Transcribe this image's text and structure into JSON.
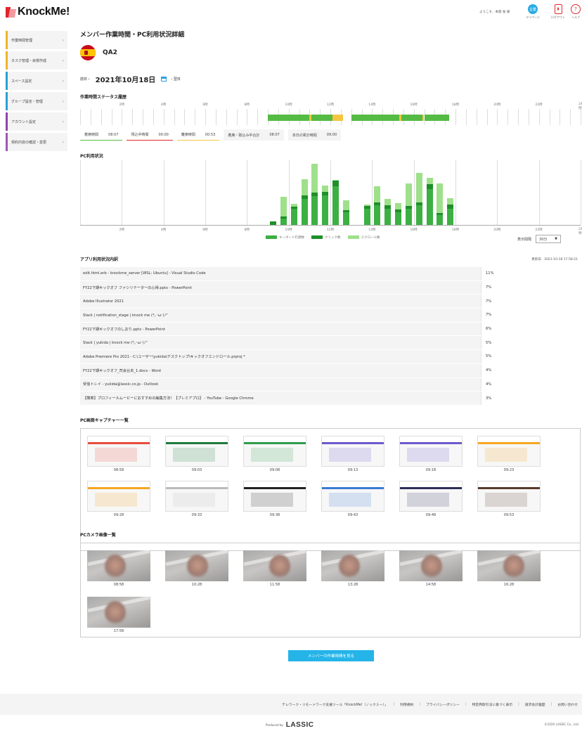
{
  "header": {
    "logo": "KnockMe!",
    "welcome": "ようこそ、本部 長 様",
    "icons": [
      {
        "name": "mypage-icon",
        "label": "マイページ",
        "badge": "企業",
        "color": "#29abe2"
      },
      {
        "name": "logout-icon",
        "label": "ログアウト",
        "color": "#e02a2a"
      },
      {
        "name": "help-icon",
        "label": "ヘルプ",
        "color": "#e02a2a"
      }
    ]
  },
  "sidebar": {
    "items": [
      {
        "label": "作業時間管理",
        "color": "#f0b429"
      },
      {
        "label": "タスク管理・目標作成",
        "color": "#f0b429"
      },
      {
        "label": "スペース設定",
        "color": "#2aa0d8"
      },
      {
        "label": "グループ設定・管理",
        "color": "#2aa0d8"
      },
      {
        "label": "アカウント設定",
        "color": "#8e44ad"
      },
      {
        "label": "契約内容の確認・変更",
        "color": "#9b59b6"
      }
    ]
  },
  "page": {
    "title": "メンバー作業時間・PC利用状況詳細",
    "member_name": "QA2",
    "prev": "前日",
    "date": "2021年10月18日",
    "next": "翌日"
  },
  "timeline": {
    "title": "作業時間ステータス履歴",
    "hours": [
      "2時",
      "4時",
      "6時",
      "8時",
      "10時",
      "12時",
      "14時",
      "16時",
      "18時",
      "20時",
      "22時",
      "24時"
    ],
    "segments": [
      {
        "start": 9.0,
        "end": 11.0,
        "status": "working"
      },
      {
        "start": 11.0,
        "end": 11.1,
        "status": "break"
      },
      {
        "start": 11.1,
        "end": 12.1,
        "status": "working"
      },
      {
        "start": 12.1,
        "end": 12.6,
        "status": "break"
      },
      {
        "start": 13.0,
        "end": 15.3,
        "status": "working"
      },
      {
        "start": 15.3,
        "end": 15.4,
        "status": "break"
      },
      {
        "start": 15.4,
        "end": 16.4,
        "status": "working"
      },
      {
        "start": 16.4,
        "end": 16.5,
        "status": "break"
      },
      {
        "start": 16.5,
        "end": 17.7,
        "status": "working"
      }
    ],
    "colors": {
      "working": "#55bb44",
      "break": "#f5c542"
    }
  },
  "summary": [
    {
      "label": "着席時間",
      "value": "08:07",
      "color": "#55bb44"
    },
    {
      "label": "残込中時間",
      "value": "00:00",
      "color": "#e02a2a"
    },
    {
      "label": "離席時間",
      "value": "00:53",
      "color": "#f5c542"
    },
    {
      "label": "着席・取込み中合計",
      "value": "08:07",
      "color": ""
    },
    {
      "label": "本日の累計時間",
      "value": "09:00",
      "color": ""
    }
  ],
  "pc_usage": {
    "title": "PC利用状況",
    "interval_label": "表示間隔",
    "interval_value": "30分"
  },
  "chart_data": {
    "type": "bar",
    "stacked": true,
    "x_unit": "hour",
    "xlim": [
      0,
      24
    ],
    "tick_labels": [
      "2時",
      "4時",
      "6時",
      "8時",
      "10時",
      "12時",
      "14時",
      "16時",
      "18時",
      "20時",
      "22時",
      "24時"
    ],
    "x": [
      8.5,
      9.0,
      9.5,
      10.0,
      10.5,
      11.0,
      11.5,
      12.0,
      12.5,
      13.0,
      13.5,
      14.0,
      14.5,
      15.0,
      15.5,
      16.0,
      16.5,
      17.0,
      17.5
    ],
    "series": [
      {
        "name": "キーボード打鍵数",
        "color": "#3cb043",
        "values": [
          0,
          0,
          10,
          25,
          40,
          45,
          46,
          60,
          20,
          0,
          25,
          30,
          25,
          20,
          25,
          30,
          55,
          15,
          25
        ]
      },
      {
        "name": "クリック数",
        "color": "#1e8f2a",
        "values": [
          0,
          5,
          3,
          3,
          6,
          5,
          5,
          8,
          3,
          0,
          4,
          5,
          5,
          4,
          4,
          5,
          8,
          4,
          6
        ]
      },
      {
        "name": "スクロール数",
        "color": "#9fe08b",
        "values": [
          0,
          0,
          30,
          5,
          25,
          45,
          10,
          2,
          15,
          0,
          3,
          25,
          10,
          10,
          35,
          45,
          10,
          45,
          10
        ]
      }
    ],
    "ylim": [
      0,
      100
    ]
  },
  "apps": {
    "title": "アプリ利用状況内訳",
    "updated": "更新日：2021-10-18 17:58:21",
    "rows": [
      {
        "name": "edit.html.erb - knockme_server [WSL: Ubuntu] - Visual Studio Code",
        "pct": "11%"
      },
      {
        "name": "FY22下期キックオフ ファシリテーターの心得.pptx - PowerPoint",
        "pct": "7%"
      },
      {
        "name": "Adobe Illustrator 2021",
        "pct": "7%"
      },
      {
        "name": "Slack | notification_stage | knock me (*｡･ω･)ﾉ\"",
        "pct": "7%"
      },
      {
        "name": "FY22下期キックオフのしおり.pptx - PowerPoint",
        "pct": "6%"
      },
      {
        "name": "Slack | yukida | knock me (*｡･ω･)ﾉ\"",
        "pct": "5%"
      },
      {
        "name": "Adobe Premiere Pro 2021 - C:\\ユーザー\\yukida\\デスクトップ\\キックオフエンドロール.prproj *",
        "pct": "5%"
      },
      {
        "name": "FY22下期キックオフ_司会台本_1.docx - Word",
        "pct": "4%"
      },
      {
        "name": "受信トレイ - yukida@lassic.co.jp - Outlook",
        "pct": "4%"
      },
      {
        "name": "【簡単】プロフィールムービーにおすすめの編集方法！【プレミアプロ】 - YouTube - Google Chrome",
        "pct": "3%"
      }
    ]
  },
  "captures": {
    "title": "PC画面キャプチャー一覧",
    "items": [
      {
        "time": "08:58",
        "accent": "#e74c3c"
      },
      {
        "time": "09:03",
        "accent": "#1e7a3c"
      },
      {
        "time": "09:08",
        "accent": "#2e9e4a"
      },
      {
        "time": "09:13",
        "accent": "#6a5acd"
      },
      {
        "time": "09:18",
        "accent": "#6a5acd"
      },
      {
        "time": "09:23",
        "accent": "#f5a623"
      },
      {
        "time": "09:28",
        "accent": "#f5a623"
      },
      {
        "time": "09:33",
        "accent": "#bbbbbb"
      },
      {
        "time": "09:38",
        "accent": "#222222"
      },
      {
        "time": "09:43",
        "accent": "#3a7bd5"
      },
      {
        "time": "09:48",
        "accent": "#2d2d5a"
      },
      {
        "time": "09:53",
        "accent": "#5a3a2a"
      }
    ]
  },
  "cameras": {
    "title": "PCカメラ画像一覧",
    "items": [
      {
        "time": "08:58"
      },
      {
        "time": "10:28"
      },
      {
        "time": "11:58"
      },
      {
        "time": "13:28"
      },
      {
        "time": "14:58"
      },
      {
        "time": "16:28"
      },
      {
        "time": "17:58"
      }
    ]
  },
  "button": {
    "label": "メンバーの作業時間を見る"
  },
  "footer": {
    "links": [
      "テレワーク・リモートワーク支援ツール「KnockMe!（ノックミー）」",
      "利用規約",
      "プライバシーポリシー",
      "特定商取引法に基づく表示",
      "請求会計履歴",
      "お問い合わせ"
    ],
    "produced_by": "Produced by",
    "brand": "LASSIC",
    "copyright": "©2020 LASSIC Co., Ltd."
  }
}
